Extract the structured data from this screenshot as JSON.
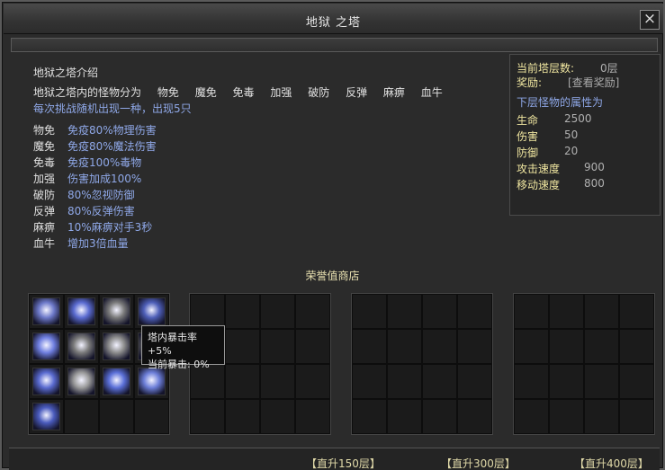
{
  "window": {
    "title": "地狱 之塔",
    "close_label": "×"
  },
  "intro": {
    "title": "地狱之塔介绍",
    "monster_prefix": "地狱之塔内的怪物分为",
    "monster_types": [
      "物免",
      "魔免",
      "免毒",
      "加强",
      "破防",
      "反弹",
      "麻痹",
      "血牛"
    ],
    "random_note": "每次挑战随机出现一种，出现5只"
  },
  "attributes": [
    {
      "name": "物免",
      "desc": "免疫80%物理伤害"
    },
    {
      "name": "魔免",
      "desc": "免疫80%魔法伤害"
    },
    {
      "name": "免毒",
      "desc": "免疫100%毒物"
    },
    {
      "name": "加强",
      "desc": "伤害加成100%"
    },
    {
      "name": "破防",
      "desc": "80%忽视防御"
    },
    {
      "name": "反弹",
      "desc": "80%反弹伤害"
    },
    {
      "name": "麻痹",
      "desc": "10%麻痹对手3秒"
    },
    {
      "name": "血牛",
      "desc": "增加3倍血量"
    }
  ],
  "info": {
    "floor_label": "当前塔层数:",
    "floor_value": "0层",
    "reward_label": "奖励:",
    "reward_link": "[查看奖励]",
    "next_header": "下层怪物的属性为",
    "stats": [
      {
        "label": "生命",
        "value": "2500"
      },
      {
        "label": "伤害",
        "value": "50"
      },
      {
        "label": "防御",
        "value": "20"
      },
      {
        "label": "攻击速度",
        "value": "900"
      },
      {
        "label": "移动速度",
        "value": "800"
      }
    ]
  },
  "shop": {
    "title": "荣誉值商店"
  },
  "tooltip": {
    "line1": "塔内暴击率+5%",
    "line2": "当前暴击: 0%"
  },
  "bottom": {
    "ascend_150": "【直升150层】",
    "ascend_300": "【直升300层】",
    "ascend_400": "【直升400层】"
  },
  "items": [
    {
      "icon": "shield-skill-icon",
      "color": "#6d79c9"
    },
    {
      "icon": "lightning-figure-skill-icon",
      "color": "#5a6bd0"
    },
    {
      "icon": "tree-spirit-skill-icon",
      "color": "#7a7a7a"
    },
    {
      "icon": "caster-figure-skill-icon",
      "color": "#4e5fb8"
    },
    {
      "icon": "ice-shard-skill-icon",
      "color": "#6f7fe0"
    },
    {
      "icon": "stone-fist-skill-icon",
      "color": "#7b7b7b"
    },
    {
      "icon": "grey-orb-skill-icon",
      "color": "#8d8d8d"
    },
    {
      "icon": "wolf-skill-icon",
      "color": "#5d5d5d"
    },
    {
      "icon": "blade-skill-icon",
      "color": "#5a6bd0"
    },
    {
      "icon": "burst-skill-icon",
      "color": "#9a9a9a"
    },
    {
      "icon": "frost-strike-skill-icon",
      "color": "#5b70d8"
    },
    {
      "icon": "snowflake-skill-icon",
      "color": "#6c7ed8"
    },
    {
      "icon": "crest-skill-icon",
      "color": "#4a5bbd"
    }
  ]
}
